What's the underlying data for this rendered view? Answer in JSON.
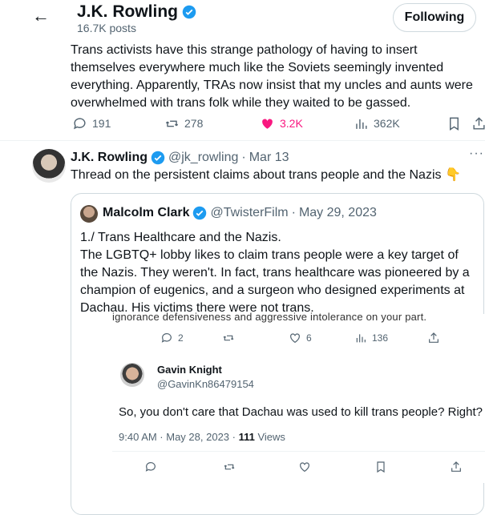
{
  "header": {
    "back_icon": "arrow-left-icon",
    "name": "J.K. Rowling",
    "posts": "16.7K posts",
    "follow_label": "Following"
  },
  "main_tweet": {
    "text": "Trans activists have this strange pathology of having to insert themselves everywhere much like the Soviets seemingly invented everything. Apparently, TRAs now insist that my uncles and aunts were overwhelmed with trans folk while they waited to be gassed.",
    "replies": "191",
    "retweets": "278",
    "likes": "3.2K",
    "views": "362K",
    "like_color": "#f91880"
  },
  "thread_tweet": {
    "name": "J.K. Rowling",
    "handle": "@jk_rowling",
    "sep": "·",
    "date": "Mar 13",
    "text": "Thread on the persistent claims about trans people and the Nazis 👇",
    "more": "···"
  },
  "quoted_tweet": {
    "name": "Malcolm Clark",
    "handle": "@TwisterFilm",
    "sep": "·",
    "date": "May 29, 2023",
    "text_line1": "1./ Trans Healthcare and the Nazis.",
    "text_line2": "The LGBTQ+ lobby likes to claim trans people were a key target of the Nazis. They weren't. In fact, trans healthcare was pioneered by a champion of eugenics, and a surgeon who designed experiments at Dachau. His victims there were not trans."
  },
  "screenshot": {
    "cut_text": "ignorance defensiveness and aggressive intolerance on your part.",
    "replies": "2",
    "likes": "6",
    "views": "136",
    "reply_name": "Gavin Knight",
    "reply_handle": "@GavinKn86479154",
    "reply_text": "So, you don't care that Dachau was used to kill trans people? Right?",
    "reply_time": "9:40 AM · May 28, 2023 · ",
    "reply_views": "111",
    "reply_views_label": " Views"
  },
  "colors": {
    "verified": "#1d9bf0",
    "muted": "#536471"
  }
}
